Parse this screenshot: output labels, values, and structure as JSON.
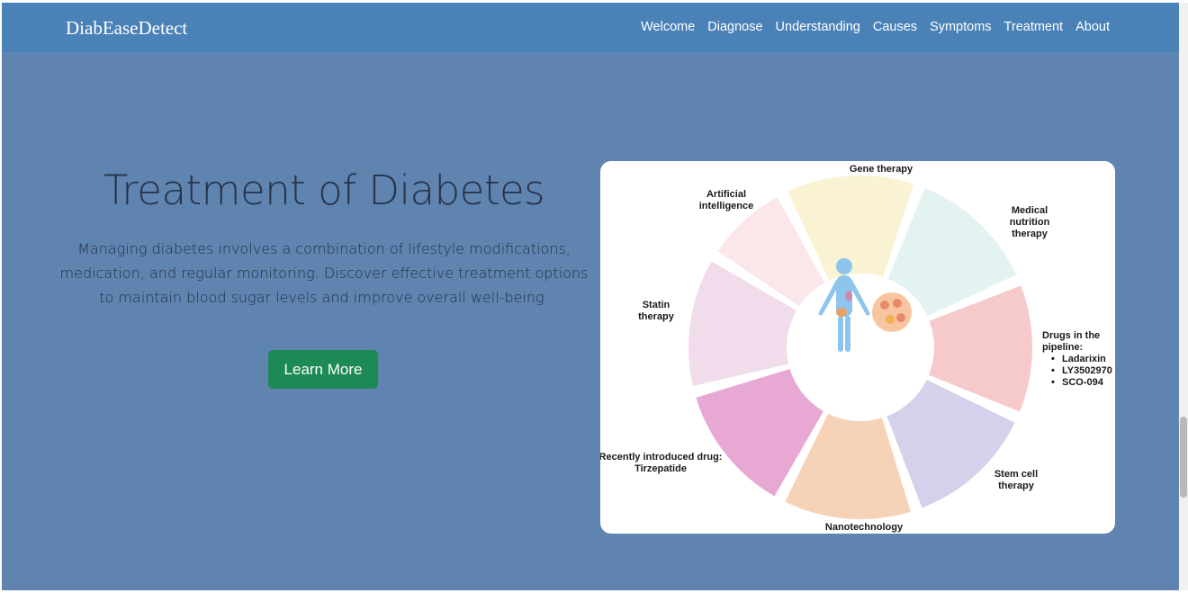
{
  "brand": "DiabEaseDetect",
  "nav": [
    "Welcome",
    "Diagnose",
    "Understanding",
    "Causes",
    "Symptoms",
    "Treatment",
    "About"
  ],
  "hero": {
    "title": "Treatment of Diabetes",
    "description": "Managing diabetes involves a combination of lifestyle modifications, medication, and regular monitoring. Discover effective treatment options to maintain blood sugar levels and improve overall well-being.",
    "button": "Learn More"
  },
  "figure": {
    "gene": "Gene therapy",
    "ai_1": "Artificial",
    "ai_2": "intelligence",
    "mnt_1": "Medical",
    "mnt_2": "nutrition",
    "mnt_3": "therapy",
    "statin_1": "Statin",
    "statin_2": "therapy",
    "pipeline_1": "Drugs in the",
    "pipeline_2": "pipeline:",
    "pipeline_items": [
      "Ladarixin",
      "LY3502970",
      "SCO-094"
    ],
    "recent_1": "Recently introduced drug:",
    "recent_2": "Tirzepatide",
    "stem_1": "Stem cell",
    "stem_2": "therapy",
    "nano": "Nanotechnology"
  },
  "colors": {
    "background": "#5f84b0",
    "navbar": "#4a82b8",
    "button": "#1d8a55"
  }
}
